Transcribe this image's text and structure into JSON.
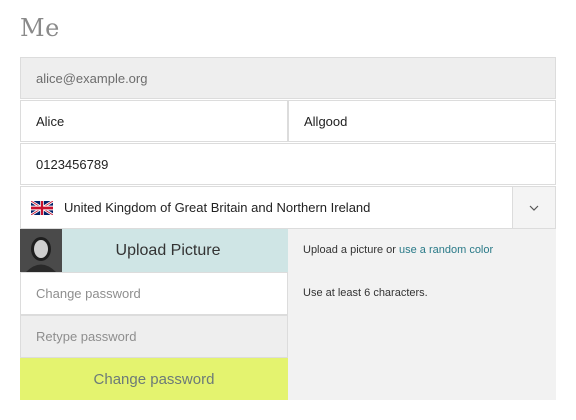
{
  "page": {
    "title": "Me"
  },
  "form": {
    "email": "alice@example.org",
    "first_name": "Alice",
    "last_name": "Allgood",
    "phone": "0123456789",
    "country": {
      "flag_icon": "uk-flag-icon",
      "label": "United Kingdom of Great Britain and Northern Ireland",
      "dropdown_icon": "chevron-down-icon"
    },
    "picture": {
      "button_label": "Upload Picture",
      "hint_prefix": "Upload a picture or ",
      "hint_link": "use a random color"
    },
    "password": {
      "placeholder": "Change password",
      "retype_placeholder": "Retype password",
      "hint": "Use at least 6 characters.",
      "submit_label": "Change password"
    }
  },
  "colors": {
    "upload_bg": "#cfe5e5",
    "submit_bg": "#e4f36f",
    "link": "#2a7a88"
  }
}
